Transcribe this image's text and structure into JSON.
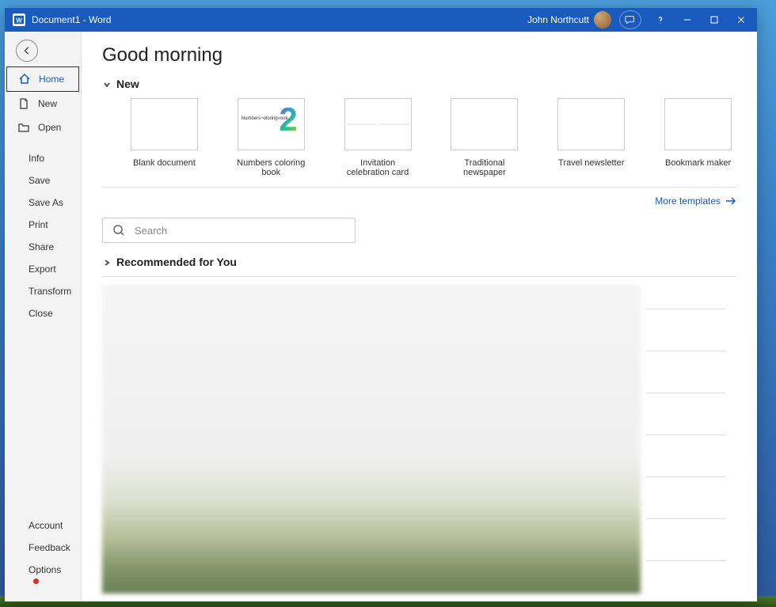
{
  "titlebar": {
    "document_name": "Document1",
    "app_name": "Word",
    "full_title": "Document1  -  Word",
    "user_name": "John Northcutt"
  },
  "sidebar": {
    "nav": [
      {
        "label": "Home",
        "icon": "home-icon",
        "active": true
      },
      {
        "label": "New",
        "icon": "document-icon",
        "active": false
      },
      {
        "label": "Open",
        "icon": "folder-icon",
        "active": false
      }
    ],
    "actions": [
      {
        "label": "Info"
      },
      {
        "label": "Save"
      },
      {
        "label": "Save As"
      },
      {
        "label": "Print"
      },
      {
        "label": "Share"
      },
      {
        "label": "Export"
      },
      {
        "label": "Transform"
      },
      {
        "label": "Close"
      }
    ],
    "bottom": [
      {
        "label": "Account"
      },
      {
        "label": "Feedback"
      },
      {
        "label": "Options",
        "dot": true
      }
    ]
  },
  "main": {
    "greeting": "Good morning",
    "new_section": "New",
    "templates": [
      {
        "label": "Blank document"
      },
      {
        "label": "Numbers coloring book"
      },
      {
        "label": "Invitation celebration card"
      },
      {
        "label": "Traditional newspaper"
      },
      {
        "label": "Travel newsletter"
      },
      {
        "label": "Bookmark maker"
      }
    ],
    "more_templates": "More templates",
    "search_placeholder": "Search",
    "recommended_section": "Recommended for You"
  }
}
